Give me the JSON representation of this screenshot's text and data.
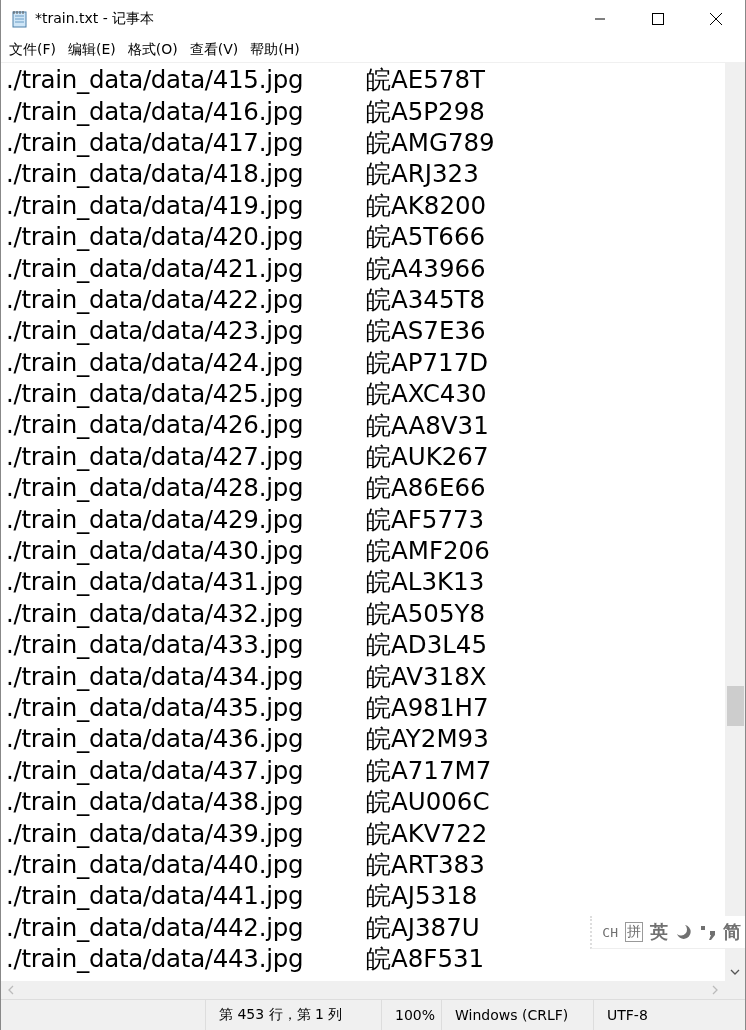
{
  "window": {
    "title": "*train.txt - 记事本"
  },
  "menu": [
    "文件(F)",
    "编辑(E)",
    "格式(O)",
    "查看(V)",
    "帮助(H)"
  ],
  "lines": [
    {
      "path": "./train_data/data/415.jpg",
      "label": "皖AE578T"
    },
    {
      "path": "./train_data/data/416.jpg",
      "label": "皖A5P298"
    },
    {
      "path": "./train_data/data/417.jpg",
      "label": "皖AMG789"
    },
    {
      "path": "./train_data/data/418.jpg",
      "label": "皖ARJ323"
    },
    {
      "path": "./train_data/data/419.jpg",
      "label": "皖AK8200"
    },
    {
      "path": "./train_data/data/420.jpg",
      "label": "皖A5T666"
    },
    {
      "path": "./train_data/data/421.jpg",
      "label": "皖A43966"
    },
    {
      "path": "./train_data/data/422.jpg",
      "label": "皖A345T8"
    },
    {
      "path": "./train_data/data/423.jpg",
      "label": "皖AS7E36"
    },
    {
      "path": "./train_data/data/424.jpg",
      "label": "皖AP717D"
    },
    {
      "path": "./train_data/data/425.jpg",
      "label": "皖AXC430"
    },
    {
      "path": "./train_data/data/426.jpg",
      "label": "皖AA8V31"
    },
    {
      "path": "./train_data/data/427.jpg",
      "label": "皖AUK267"
    },
    {
      "path": "./train_data/data/428.jpg",
      "label": "皖A86E66"
    },
    {
      "path": "./train_data/data/429.jpg",
      "label": "皖AF5773"
    },
    {
      "path": "./train_data/data/430.jpg",
      "label": "皖AMF206"
    },
    {
      "path": "./train_data/data/431.jpg",
      "label": "皖AL3K13"
    },
    {
      "path": "./train_data/data/432.jpg",
      "label": "皖A505Y8"
    },
    {
      "path": "./train_data/data/433.jpg",
      "label": "皖AD3L45"
    },
    {
      "path": "./train_data/data/434.jpg",
      "label": "皖AV318X"
    },
    {
      "path": "./train_data/data/435.jpg",
      "label": "皖A981H7"
    },
    {
      "path": "./train_data/data/436.jpg",
      "label": "皖AY2M93"
    },
    {
      "path": "./train_data/data/437.jpg",
      "label": "皖A717M7"
    },
    {
      "path": "./train_data/data/438.jpg",
      "label": "皖AU006C"
    },
    {
      "path": "./train_data/data/439.jpg",
      "label": "皖AKV722"
    },
    {
      "path": "./train_data/data/440.jpg",
      "label": "皖ART383"
    },
    {
      "path": "./train_data/data/441.jpg",
      "label": "皖AJ5318"
    },
    {
      "path": "./train_data/data/442.jpg",
      "label": "皖AJ387U"
    },
    {
      "path": "./train_data/data/443.jpg",
      "label": "皖A8F531"
    }
  ],
  "ime": [
    {
      "kind": "text",
      "text": "CH"
    },
    {
      "kind": "boxed",
      "text": "拼"
    },
    {
      "kind": "text",
      "text": "英"
    },
    {
      "kind": "moon"
    },
    {
      "kind": "punct"
    },
    {
      "kind": "text",
      "text": "简"
    }
  ],
  "status_bar": [
    "第 453 行，第 1 列",
    "100%",
    "Windows (CRLF)",
    "UTF-8"
  ]
}
